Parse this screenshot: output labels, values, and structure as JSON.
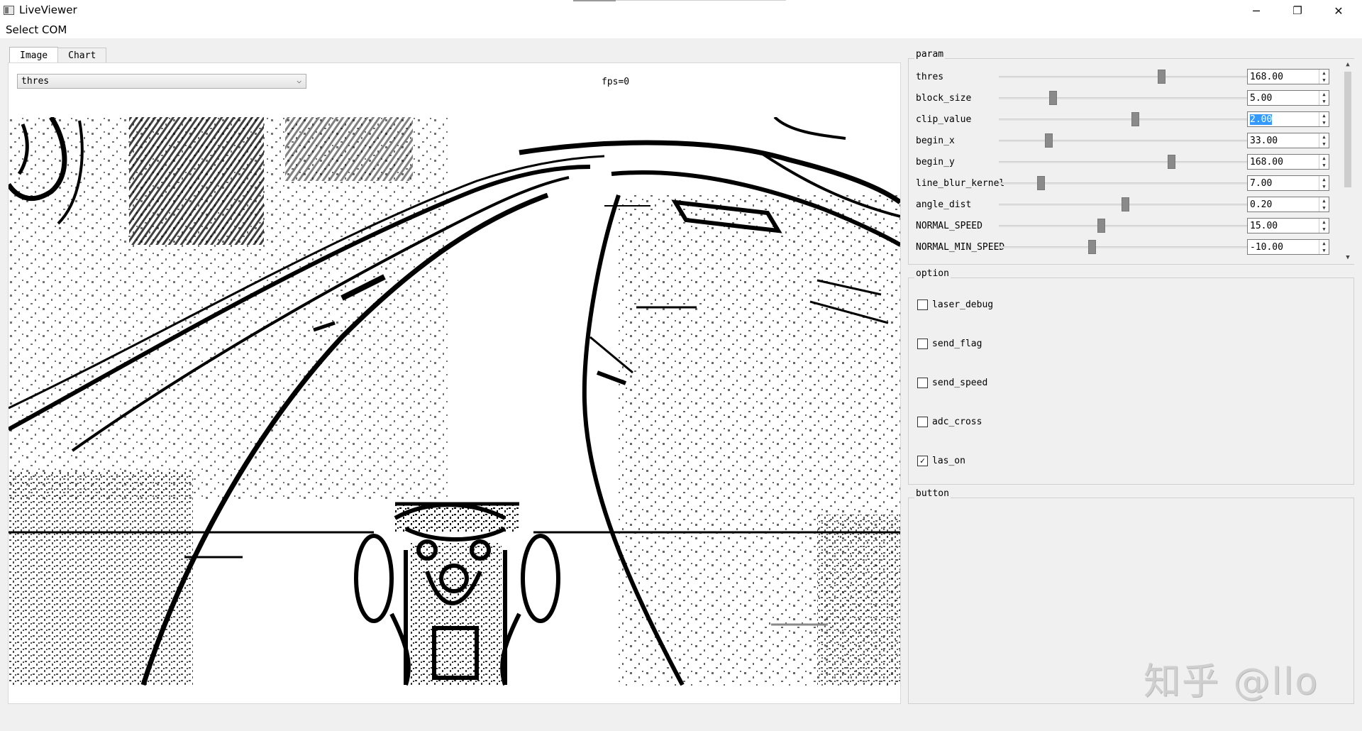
{
  "window": {
    "title": "LiveViewer",
    "controls": {
      "minimize": "─",
      "maximize": "❐",
      "close": "✕"
    }
  },
  "menu": {
    "items": [
      "Select COM"
    ]
  },
  "tabs": [
    {
      "label": "Image",
      "active": true
    },
    {
      "label": "Chart",
      "active": false
    }
  ],
  "image_view": {
    "display_select": "thres",
    "fps": "fps=0"
  },
  "param": {
    "title": "param",
    "rows": [
      {
        "name": "thres",
        "value": "168.00",
        "slider_fraction": 0.66
      },
      {
        "name": "block_size",
        "value": "5.00",
        "slider_fraction": 0.21
      },
      {
        "name": "clip_value",
        "value": "2.00",
        "slider_fraction": 0.55,
        "selected": true
      },
      {
        "name": "begin_x",
        "value": "33.00",
        "slider_fraction": 0.19
      },
      {
        "name": "begin_y",
        "value": "168.00",
        "slider_fraction": 0.7
      },
      {
        "name": "line_blur_kernel",
        "value": "7.00",
        "slider_fraction": 0.16
      },
      {
        "name": "angle_dist",
        "value": "0.20",
        "slider_fraction": 0.51
      },
      {
        "name": "NORMAL_SPEED",
        "value": "15.00",
        "slider_fraction": 0.41
      },
      {
        "name": "NORMAL_MIN_SPEED",
        "value": "-10.00",
        "slider_fraction": 0.37
      }
    ]
  },
  "option": {
    "title": "option",
    "items": [
      {
        "label": "laser_debug",
        "checked": false
      },
      {
        "label": "send_flag",
        "checked": false
      },
      {
        "label": "send_speed",
        "checked": false
      },
      {
        "label": "adc_cross",
        "checked": false
      },
      {
        "label": "las_on",
        "checked": true
      }
    ]
  },
  "button_group": {
    "title": "button"
  },
  "watermark": "知乎 @llo"
}
